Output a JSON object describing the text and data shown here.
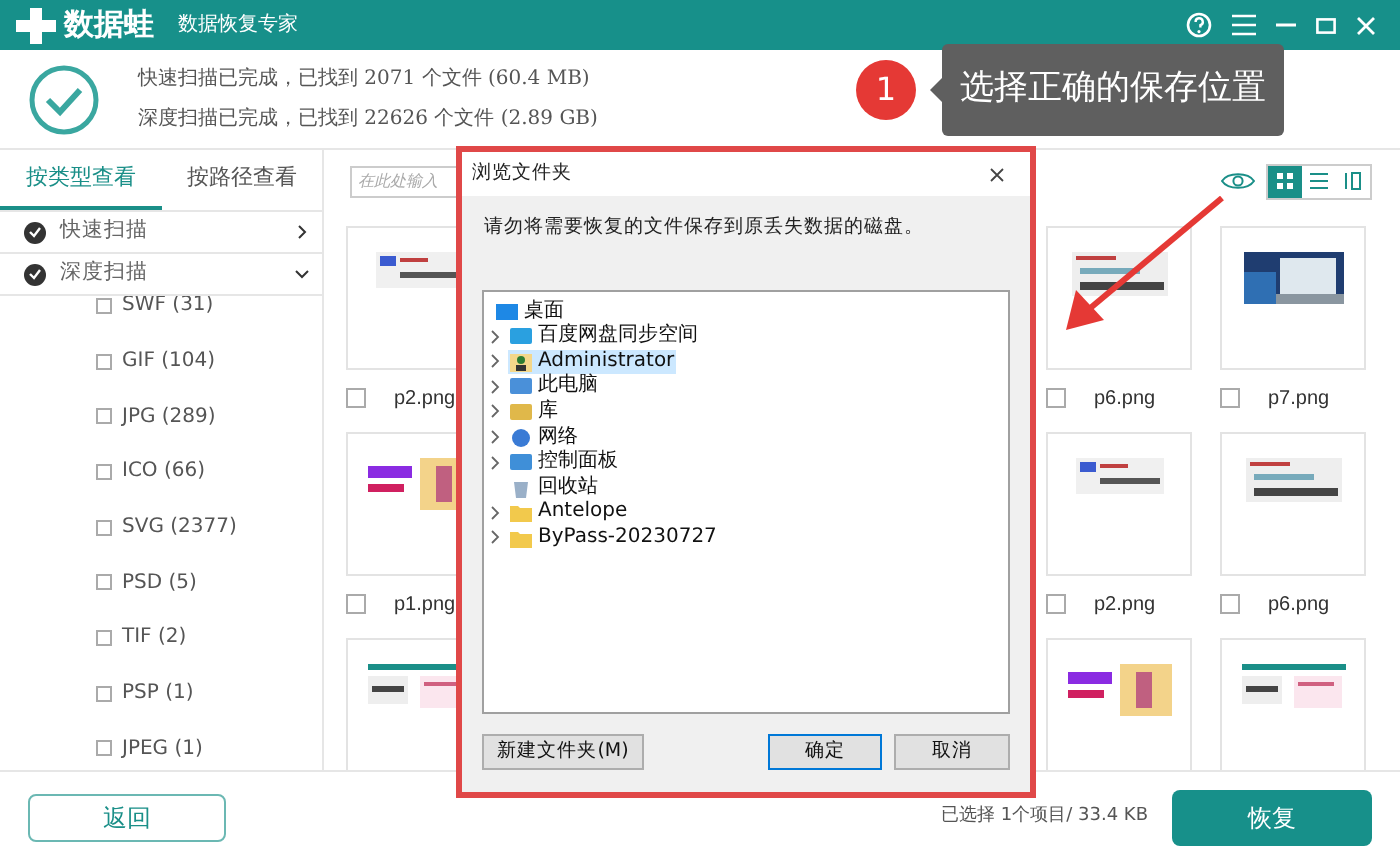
{
  "app": {
    "brand": "数据蛙",
    "subtitle": "数据恢复专家"
  },
  "status": [
    "快速扫描已完成，已找到 2071 个文件 (60.4 MB)",
    "深度扫描已完成，已找到 22626 个文件 (2.89 GB)"
  ],
  "callout": {
    "step": "1",
    "text": "选择正确的保存位置"
  },
  "tabs": [
    {
      "label": "按类型查看",
      "selected": true
    },
    {
      "label": "按路径查看",
      "selected": false
    }
  ],
  "scans": [
    {
      "label": "快速扫描",
      "checked": true,
      "expanded": false
    },
    {
      "label": "深度扫描",
      "checked": true,
      "expanded": true
    }
  ],
  "file_types": [
    {
      "label": "SWF (31)",
      "checked": false
    },
    {
      "label": "GIF (104)",
      "checked": false
    },
    {
      "label": "JPG (289)",
      "checked": false
    },
    {
      "label": "ICO (66)",
      "checked": false
    },
    {
      "label": "SVG (2377)",
      "checked": false
    },
    {
      "label": "PSD (5)",
      "checked": false
    },
    {
      "label": "TIF (2)",
      "checked": false
    },
    {
      "label": "PSP (1)",
      "checked": false
    },
    {
      "label": "JPEG (1)",
      "checked": false
    }
  ],
  "search": {
    "placeholder": "在此处输入"
  },
  "views": [
    {
      "kind": "grid",
      "selected": true
    },
    {
      "kind": "list",
      "selected": false
    },
    {
      "kind": "columns",
      "selected": false
    }
  ],
  "files_left": [
    {
      "kind": "toolbar",
      "name": "p2.png",
      "checked": false
    },
    {
      "kind": "banner",
      "name": "p1.png",
      "checked": false
    },
    {
      "kind": "window"
    }
  ],
  "files_right": [
    {
      "kind": "dialog",
      "name": "p6.png",
      "checked": false
    },
    {
      "name": "p7.png",
      "checked": false
    },
    {
      "kind": "toolbar",
      "name": "p2.png",
      "checked": false
    },
    {
      "kind": "dialog",
      "name": "p6.png",
      "checked": false
    },
    {
      "kind": "banner"
    },
    {
      "kind": "window"
    }
  ],
  "dialog": {
    "title": "浏览文件夹",
    "message": "请勿将需要恢复的文件保存到原丢失数据的磁盘。",
    "tree": [
      {
        "label": "桌面",
        "kind": "desktop",
        "selected": false,
        "children": [
          {
            "label": "百度网盘同步空间",
            "kind": "cloud",
            "selected": false,
            "expandable": true
          },
          {
            "label": "Administrator",
            "kind": "user",
            "selected": true,
            "expandable": true
          },
          {
            "label": "此电脑",
            "kind": "computer",
            "selected": false,
            "expandable": true
          },
          {
            "label": "库",
            "kind": "library",
            "selected": false,
            "expandable": true
          },
          {
            "label": "网络",
            "kind": "network",
            "selected": false,
            "expandable": true
          },
          {
            "label": "控制面板",
            "kind": "panel",
            "selected": false,
            "expandable": true
          },
          {
            "label": "回收站",
            "kind": "bin",
            "selected": false,
            "expandable": false
          },
          {
            "label": "Antelope",
            "kind": "folder",
            "selected": false,
            "expandable": true
          },
          {
            "label": "ByPass-20230727",
            "kind": "folder",
            "selected": false,
            "expandable": true
          }
        ]
      }
    ],
    "buttons": [
      "新建文件夹(M)",
      "确定",
      "取消"
    ]
  },
  "footer": {
    "back": "返回",
    "selection": "已选择 1个项目/ 33.4 KB",
    "recover": "恢复"
  }
}
